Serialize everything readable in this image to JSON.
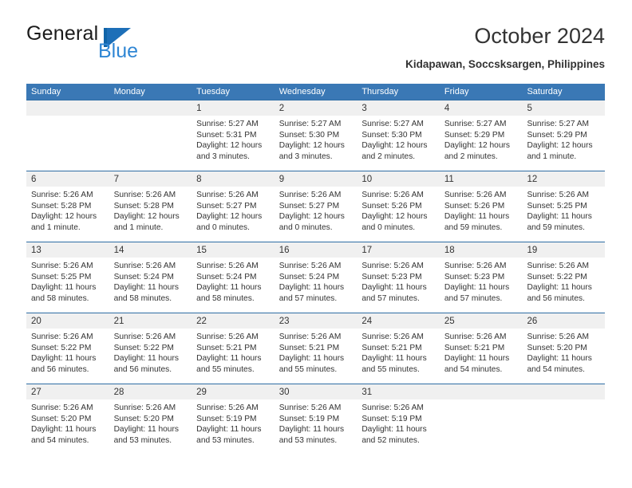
{
  "brand": {
    "name_dark": "General",
    "name_blue": "Blue",
    "flag_icon": "general-blue-flag-logo",
    "accent_blue": "#1d6fb8",
    "light_blue": "#2f86d4"
  },
  "header": {
    "title": "October 2024",
    "location": "Kidapawan, Soccsksargen, Philippines"
  },
  "calendar": {
    "header_bg": "#3a78b5",
    "row_border": "#2e6da4",
    "numband_bg": "#f0f0f0",
    "weekdays": [
      "Sunday",
      "Monday",
      "Tuesday",
      "Wednesday",
      "Thursday",
      "Friday",
      "Saturday"
    ],
    "weeks": [
      [
        {
          "day": ""
        },
        {
          "day": ""
        },
        {
          "day": "1",
          "sunrise": "Sunrise: 5:27 AM",
          "sunset": "Sunset: 5:31 PM",
          "daylight1": "Daylight: 12 hours",
          "daylight2": "and 3 minutes."
        },
        {
          "day": "2",
          "sunrise": "Sunrise: 5:27 AM",
          "sunset": "Sunset: 5:30 PM",
          "daylight1": "Daylight: 12 hours",
          "daylight2": "and 3 minutes."
        },
        {
          "day": "3",
          "sunrise": "Sunrise: 5:27 AM",
          "sunset": "Sunset: 5:30 PM",
          "daylight1": "Daylight: 12 hours",
          "daylight2": "and 2 minutes."
        },
        {
          "day": "4",
          "sunrise": "Sunrise: 5:27 AM",
          "sunset": "Sunset: 5:29 PM",
          "daylight1": "Daylight: 12 hours",
          "daylight2": "and 2 minutes."
        },
        {
          "day": "5",
          "sunrise": "Sunrise: 5:27 AM",
          "sunset": "Sunset: 5:29 PM",
          "daylight1": "Daylight: 12 hours",
          "daylight2": "and 1 minute."
        }
      ],
      [
        {
          "day": "6",
          "sunrise": "Sunrise: 5:26 AM",
          "sunset": "Sunset: 5:28 PM",
          "daylight1": "Daylight: 12 hours",
          "daylight2": "and 1 minute."
        },
        {
          "day": "7",
          "sunrise": "Sunrise: 5:26 AM",
          "sunset": "Sunset: 5:28 PM",
          "daylight1": "Daylight: 12 hours",
          "daylight2": "and 1 minute."
        },
        {
          "day": "8",
          "sunrise": "Sunrise: 5:26 AM",
          "sunset": "Sunset: 5:27 PM",
          "daylight1": "Daylight: 12 hours",
          "daylight2": "and 0 minutes."
        },
        {
          "day": "9",
          "sunrise": "Sunrise: 5:26 AM",
          "sunset": "Sunset: 5:27 PM",
          "daylight1": "Daylight: 12 hours",
          "daylight2": "and 0 minutes."
        },
        {
          "day": "10",
          "sunrise": "Sunrise: 5:26 AM",
          "sunset": "Sunset: 5:26 PM",
          "daylight1": "Daylight: 12 hours",
          "daylight2": "and 0 minutes."
        },
        {
          "day": "11",
          "sunrise": "Sunrise: 5:26 AM",
          "sunset": "Sunset: 5:26 PM",
          "daylight1": "Daylight: 11 hours",
          "daylight2": "and 59 minutes."
        },
        {
          "day": "12",
          "sunrise": "Sunrise: 5:26 AM",
          "sunset": "Sunset: 5:25 PM",
          "daylight1": "Daylight: 11 hours",
          "daylight2": "and 59 minutes."
        }
      ],
      [
        {
          "day": "13",
          "sunrise": "Sunrise: 5:26 AM",
          "sunset": "Sunset: 5:25 PM",
          "daylight1": "Daylight: 11 hours",
          "daylight2": "and 58 minutes."
        },
        {
          "day": "14",
          "sunrise": "Sunrise: 5:26 AM",
          "sunset": "Sunset: 5:24 PM",
          "daylight1": "Daylight: 11 hours",
          "daylight2": "and 58 minutes."
        },
        {
          "day": "15",
          "sunrise": "Sunrise: 5:26 AM",
          "sunset": "Sunset: 5:24 PM",
          "daylight1": "Daylight: 11 hours",
          "daylight2": "and 58 minutes."
        },
        {
          "day": "16",
          "sunrise": "Sunrise: 5:26 AM",
          "sunset": "Sunset: 5:24 PM",
          "daylight1": "Daylight: 11 hours",
          "daylight2": "and 57 minutes."
        },
        {
          "day": "17",
          "sunrise": "Sunrise: 5:26 AM",
          "sunset": "Sunset: 5:23 PM",
          "daylight1": "Daylight: 11 hours",
          "daylight2": "and 57 minutes."
        },
        {
          "day": "18",
          "sunrise": "Sunrise: 5:26 AM",
          "sunset": "Sunset: 5:23 PM",
          "daylight1": "Daylight: 11 hours",
          "daylight2": "and 57 minutes."
        },
        {
          "day": "19",
          "sunrise": "Sunrise: 5:26 AM",
          "sunset": "Sunset: 5:22 PM",
          "daylight1": "Daylight: 11 hours",
          "daylight2": "and 56 minutes."
        }
      ],
      [
        {
          "day": "20",
          "sunrise": "Sunrise: 5:26 AM",
          "sunset": "Sunset: 5:22 PM",
          "daylight1": "Daylight: 11 hours",
          "daylight2": "and 56 minutes."
        },
        {
          "day": "21",
          "sunrise": "Sunrise: 5:26 AM",
          "sunset": "Sunset: 5:22 PM",
          "daylight1": "Daylight: 11 hours",
          "daylight2": "and 56 minutes."
        },
        {
          "day": "22",
          "sunrise": "Sunrise: 5:26 AM",
          "sunset": "Sunset: 5:21 PM",
          "daylight1": "Daylight: 11 hours",
          "daylight2": "and 55 minutes."
        },
        {
          "day": "23",
          "sunrise": "Sunrise: 5:26 AM",
          "sunset": "Sunset: 5:21 PM",
          "daylight1": "Daylight: 11 hours",
          "daylight2": "and 55 minutes."
        },
        {
          "day": "24",
          "sunrise": "Sunrise: 5:26 AM",
          "sunset": "Sunset: 5:21 PM",
          "daylight1": "Daylight: 11 hours",
          "daylight2": "and 55 minutes."
        },
        {
          "day": "25",
          "sunrise": "Sunrise: 5:26 AM",
          "sunset": "Sunset: 5:21 PM",
          "daylight1": "Daylight: 11 hours",
          "daylight2": "and 54 minutes."
        },
        {
          "day": "26",
          "sunrise": "Sunrise: 5:26 AM",
          "sunset": "Sunset: 5:20 PM",
          "daylight1": "Daylight: 11 hours",
          "daylight2": "and 54 minutes."
        }
      ],
      [
        {
          "day": "27",
          "sunrise": "Sunrise: 5:26 AM",
          "sunset": "Sunset: 5:20 PM",
          "daylight1": "Daylight: 11 hours",
          "daylight2": "and 54 minutes."
        },
        {
          "day": "28",
          "sunrise": "Sunrise: 5:26 AM",
          "sunset": "Sunset: 5:20 PM",
          "daylight1": "Daylight: 11 hours",
          "daylight2": "and 53 minutes."
        },
        {
          "day": "29",
          "sunrise": "Sunrise: 5:26 AM",
          "sunset": "Sunset: 5:19 PM",
          "daylight1": "Daylight: 11 hours",
          "daylight2": "and 53 minutes."
        },
        {
          "day": "30",
          "sunrise": "Sunrise: 5:26 AM",
          "sunset": "Sunset: 5:19 PM",
          "daylight1": "Daylight: 11 hours",
          "daylight2": "and 53 minutes."
        },
        {
          "day": "31",
          "sunrise": "Sunrise: 5:26 AM",
          "sunset": "Sunset: 5:19 PM",
          "daylight1": "Daylight: 11 hours",
          "daylight2": "and 52 minutes."
        },
        {
          "day": ""
        },
        {
          "day": ""
        }
      ]
    ]
  }
}
